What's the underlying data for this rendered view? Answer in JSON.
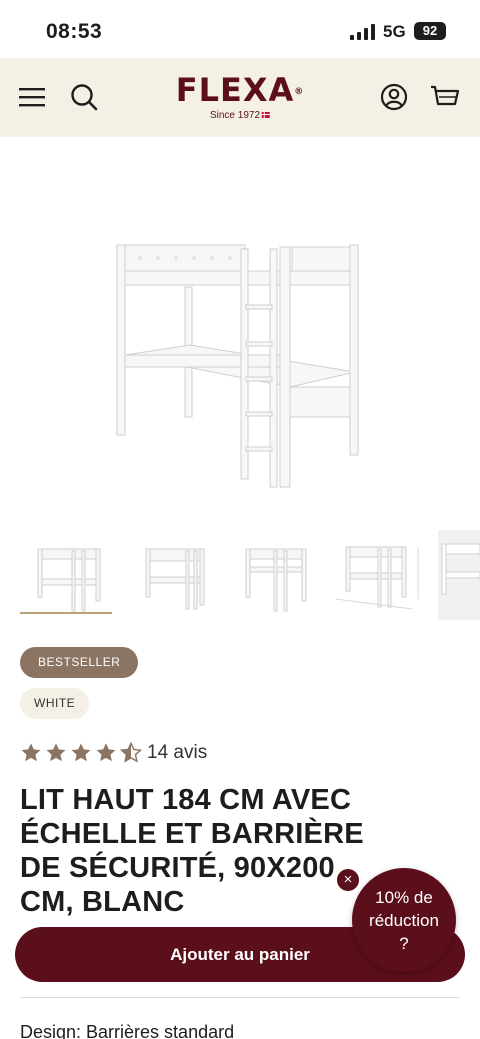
{
  "status_bar": {
    "time": "08:53",
    "network": "5G",
    "battery": "92"
  },
  "header": {
    "logo": "FLEXA",
    "logo_mark": "®",
    "since": "Since 1972",
    "brand_color": "#5b0f1b",
    "background_color": "#f4f0e6",
    "icons": [
      "menu-icon",
      "search-icon",
      "account-icon",
      "cart-icon"
    ]
  },
  "product": {
    "badges": {
      "bestseller": "BESTSELLER",
      "color": "WHITE"
    },
    "rating": {
      "stars": 4.5,
      "max_stars": 5,
      "reviews": "14 avis"
    },
    "title": "LIT HAUT 184 CM AVEC ÉCHELLE ET BARRIÈRE DE SÉCURITÉ, 90X200 CM, BLANC",
    "design_line": "Design: Barrières standard"
  },
  "gallery": {
    "thumbnail_count": 5,
    "active_index": 0
  },
  "promo": {
    "line1": "10% de",
    "line2": "réduction",
    "line3": "?",
    "close": "×"
  },
  "actions": {
    "add_to_cart": "Ajouter au panier"
  }
}
